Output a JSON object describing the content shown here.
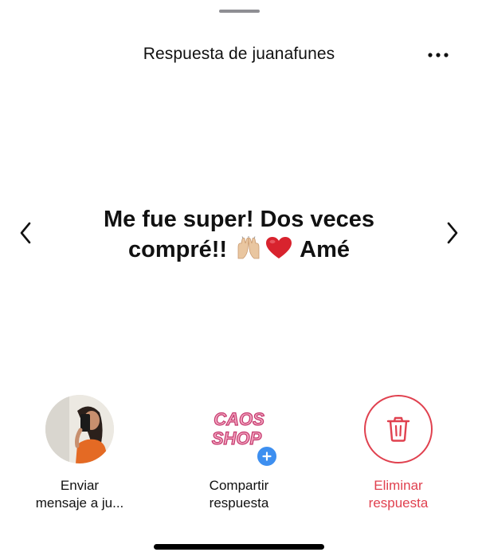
{
  "header": {
    "title": "Respuesta de juanafunes",
    "more_icon": "more-horizontal-icon"
  },
  "response": {
    "text_line1": "Me fue super! Dos veces",
    "text_line2_start": "compré!!",
    "text_line2_end": "Amé",
    "emojis": [
      "raising-hands-emoji",
      "red-heart-emoji"
    ]
  },
  "navigation": {
    "prev_icon": "chevron-left-icon",
    "next_icon": "chevron-right-icon"
  },
  "actions": [
    {
      "label_line1": "Enviar",
      "label_line2": "mensaje a ju...",
      "icon": "avatar"
    },
    {
      "label_line1": "Compartir",
      "label_line2": "respuesta",
      "icon": "caos-shop-logo",
      "logo_text_1": "CAOS",
      "logo_text_2": "SHOP",
      "badge_icon": "plus-icon"
    },
    {
      "label_line1": "Eliminar",
      "label_line2": "respuesta",
      "icon": "trash-icon",
      "color": "#e0414f"
    }
  ],
  "colors": {
    "danger": "#e0414f",
    "accent_blue": "#3d8ff0",
    "logo_pink": "#e85a8c"
  }
}
